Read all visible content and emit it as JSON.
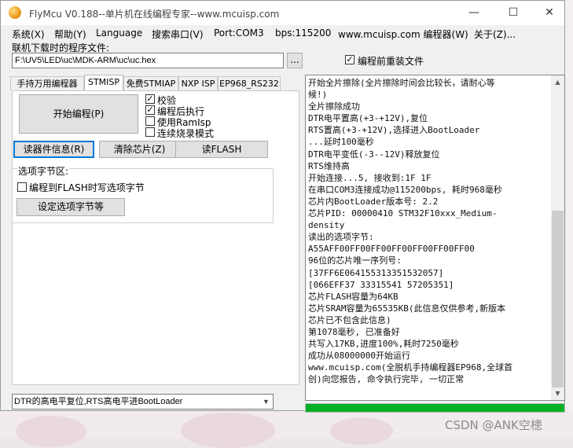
{
  "window": {
    "title": "FlyMcu V0.188--单片机在线编程专家--www.mcuisp.com",
    "minimize": "—",
    "maximize": "☐",
    "close": "✕"
  },
  "menu": {
    "items": [
      "系统(X)",
      "帮助(Y)",
      "Language",
      "搜索串口(V)",
      "Port:COM3",
      "bps:115200",
      "www.mcuisp.com 编程器(W)",
      "关于(Z)..."
    ]
  },
  "file": {
    "label": "联机下载时的程序文件:",
    "path": "F:\\UV5\\LED\\uc\\MDK-ARM\\uc\\uc.hex",
    "browse": "...",
    "reload_label": "编程前重装文件",
    "reload_checked": true
  },
  "tabs": [
    "手持万用编程器",
    "STMISP",
    "免费STMIAP",
    "NXP ISP",
    "EP968_RS232"
  ],
  "active_tab": "STMISP",
  "stmisp": {
    "start_button": "开始编程(P)",
    "options": [
      {
        "label": "校验",
        "checked": true
      },
      {
        "label": "编程后执行",
        "checked": true
      },
      {
        "label": "使用RamIsp",
        "checked": false
      },
      {
        "label": "连续烧录模式",
        "checked": false
      }
    ],
    "read_info_button": "读器件信息(R)",
    "erase_button": "清除芯片(Z)",
    "read_flash_button": "读FLASH",
    "option_bytes_title": "选项字节区:",
    "write_option_label": "编程到FLASH时写选项字节",
    "write_option_checked": false,
    "set_option_button": "设定选项字节等"
  },
  "boot_mode": {
    "selected": "DTR的高电平复位,RTS高电平进BootLoader",
    "arrow": "▼"
  },
  "log": {
    "lines": [
      "开始全片擦除(全片擦除时间会比较长，请耐心等",
      "候!)",
      "全片擦除成功",
      "DTR电平置高(+3-+12V),复位",
      "RTS置高(+3-+12V),选择进入BootLoader",
      "...延时100毫秒",
      "DTR电平变低(-3--12V)释放复位",
      "RTS维持高",
      "开始连接...5, 接收到:1F 1F",
      "在串口COM3连接成功@115200bps, 耗时968毫秒",
      "芯片内BootLoader版本号: 2.2",
      "芯片PID: 00000410  STM32F10xxx_Medium-",
      "density",
      "读出的选项字节:",
      "A55AFF00FF00FF00FF00FF00FF00FF00",
      "96位的芯片唯一序列号:",
      "[37FF6E064155313351532057]",
      "[066EFF37 33315541 57205351]",
      "芯片FLASH容量为64KB",
      "芯片SRAM容量为65535KB(此信息仅供参考,新版本",
      "芯片已不包含此信息)",
      "第1078毫秒, 已准备好",
      "共写入17KB,进度100%,耗时7250毫秒",
      "成功从08000000开始运行",
      "www.mcuisp.com(全脱机手持编程器EP968,全球首",
      "创)向您报告, 命令执行完毕, 一切正常"
    ],
    "scroll_up": "▲",
    "scroll_down": "▼"
  },
  "progress": {
    "value": 1.0,
    "color": "#06b025"
  },
  "watermark": "CSDN @ANK空槵"
}
